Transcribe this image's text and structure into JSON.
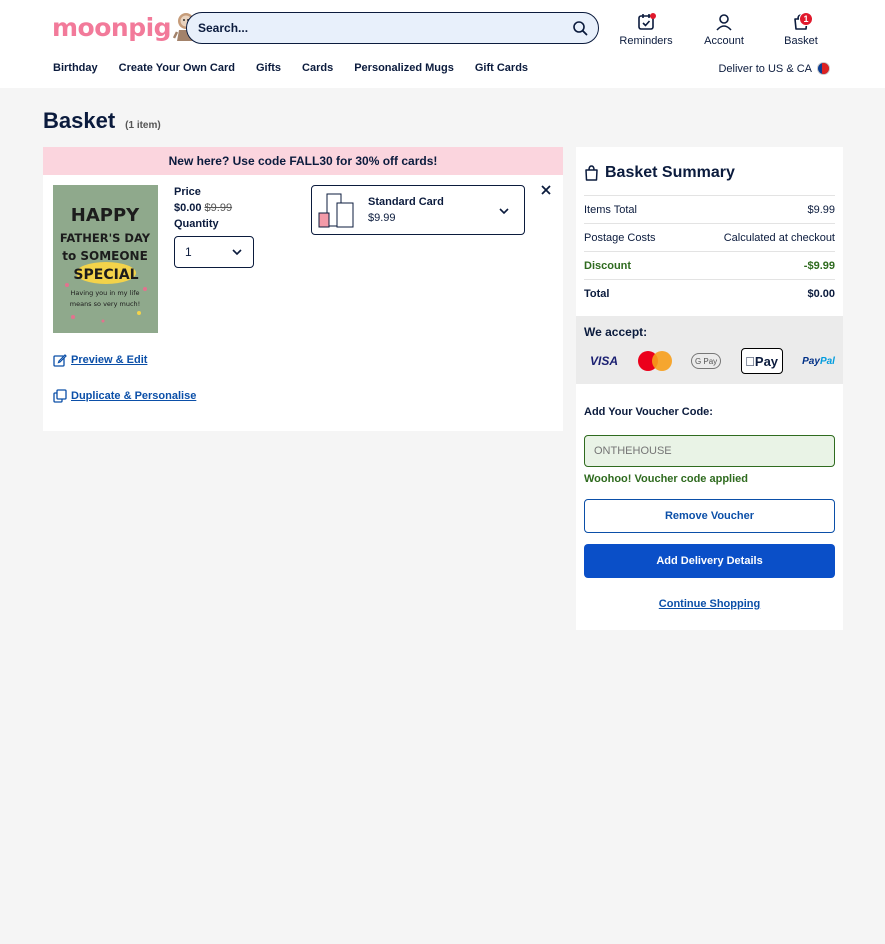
{
  "header": {
    "logo": "moonpig",
    "search": {
      "placeholder": "Search..."
    },
    "reminders_label": "Reminders",
    "account_label": "Account",
    "basket_label": "Basket",
    "basket_count": "1"
  },
  "nav": {
    "items": [
      "Birthday",
      "Create Your Own Card",
      "Gifts",
      "Cards",
      "Personalized Mugs",
      "Gift Cards"
    ],
    "deliver_label": "Deliver to US & CA"
  },
  "page": {
    "title": "Basket",
    "item_count": "(1 item)"
  },
  "item": {
    "promo": "New here? Use code FALL30 for 30% off cards!",
    "card_text": {
      "line1": "HAPPY",
      "line2": "FATHER'S DAY",
      "line3": "to SOMEONE",
      "line4": "SPECIAL",
      "line5": "Having you in my life",
      "line6": "means so very much!"
    },
    "price_label": "Price",
    "price": "$0.00",
    "price_old": "$9.99",
    "quantity_label": "Quantity",
    "quantity": "1",
    "card_type_name": "Standard Card",
    "card_type_price": "$9.99",
    "preview_label": "Preview & Edit",
    "duplicate_label": "Duplicate & Personalise"
  },
  "summary": {
    "title": "Basket Summary",
    "rows": [
      {
        "label": "Items Total",
        "value": "$9.99"
      },
      {
        "label": "Postage Costs",
        "value": "Calculated at checkout"
      },
      {
        "label": "Discount",
        "value": "-$9.99"
      },
      {
        "label": "Total",
        "value": "$0.00"
      }
    ],
    "accept_label": "We accept:",
    "payments": {
      "visa": "VISA",
      "gpay": "G Pay",
      "apple": "Pay",
      "paypal_a": "Pay",
      "paypal_b": "Pal"
    },
    "voucher_label": "Add Your Voucher Code:",
    "voucher_placeholder": "ONTHEHOUSE",
    "voucher_success": "Woohoo! Voucher code applied",
    "remove_voucher": "Remove Voucher",
    "add_delivery": "Add Delivery Details",
    "continue_shopping": "Continue Shopping"
  },
  "colors": {
    "brand_pink": "#f27a9a",
    "navy": "#0b1b3d",
    "primary_blue": "#0a4fc8",
    "success_green": "#2f6b1f",
    "promo_pink": "#fbd5de"
  }
}
